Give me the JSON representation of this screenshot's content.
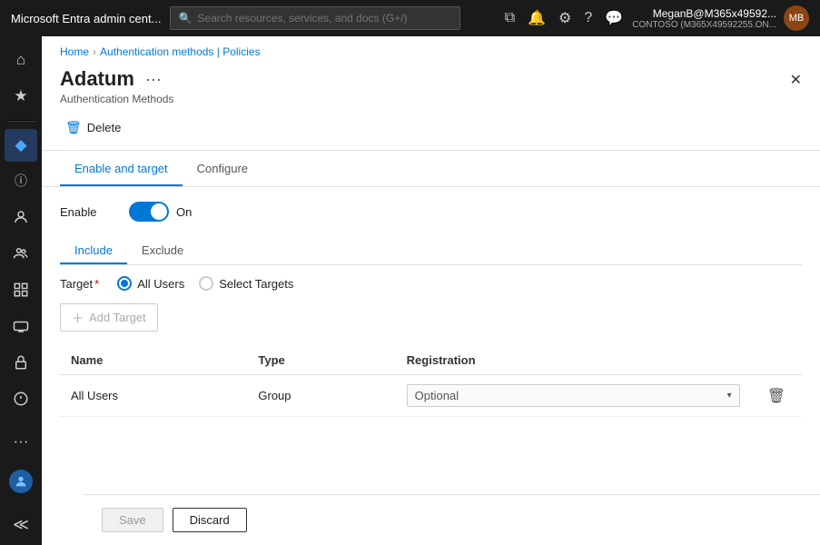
{
  "topbar": {
    "title": "Microsoft Entra admin cent...",
    "search_placeholder": "Search resources, services, and docs (G+/)",
    "user_name": "MeganB@M365x49592...",
    "user_tenant": "CONTOSO (M365X49592255.ON...",
    "user_initials": "MB"
  },
  "breadcrumb": {
    "home": "Home",
    "section": "Authentication methods | Policies"
  },
  "page": {
    "title": "Adatum",
    "subtitle": "Authentication Methods"
  },
  "actions": {
    "delete_label": "Delete",
    "more_icon": "···"
  },
  "tabs": {
    "items": [
      {
        "label": "Enable and target",
        "active": true
      },
      {
        "label": "Configure",
        "active": false
      }
    ]
  },
  "enable_section": {
    "label": "Enable",
    "state": "On"
  },
  "sub_tabs": {
    "items": [
      {
        "label": "Include",
        "active": true
      },
      {
        "label": "Exclude",
        "active": false
      }
    ]
  },
  "target_section": {
    "label": "Target",
    "required": "*",
    "options": [
      {
        "label": "All Users",
        "selected": true
      },
      {
        "label": "Select Targets",
        "selected": false
      }
    ]
  },
  "add_target": {
    "label": "Add Target"
  },
  "table": {
    "columns": [
      "Name",
      "Type",
      "Registration"
    ],
    "rows": [
      {
        "name": "All Users",
        "type": "Group",
        "registration": "Optional"
      }
    ]
  },
  "footer": {
    "save_label": "Save",
    "discard_label": "Discard"
  },
  "sidebar": {
    "items": [
      {
        "icon": "⌂",
        "name": "home",
        "active": false
      },
      {
        "icon": "★",
        "name": "favorites",
        "active": false
      },
      {
        "icon": "—",
        "name": "divider1"
      },
      {
        "icon": "◆",
        "name": "identity",
        "active": true
      },
      {
        "icon": "ℹ",
        "name": "info",
        "active": false
      },
      {
        "icon": "👤",
        "name": "users",
        "active": false
      },
      {
        "icon": "👥",
        "name": "groups",
        "active": false
      },
      {
        "icon": "📋",
        "name": "apps",
        "active": false
      },
      {
        "icon": "🔲",
        "name": "devices",
        "active": false
      },
      {
        "icon": "🔒",
        "name": "security",
        "active": false
      },
      {
        "icon": "⚙",
        "name": "settings",
        "active": false
      },
      {
        "icon": "🔑",
        "name": "keys",
        "active": false
      }
    ]
  }
}
